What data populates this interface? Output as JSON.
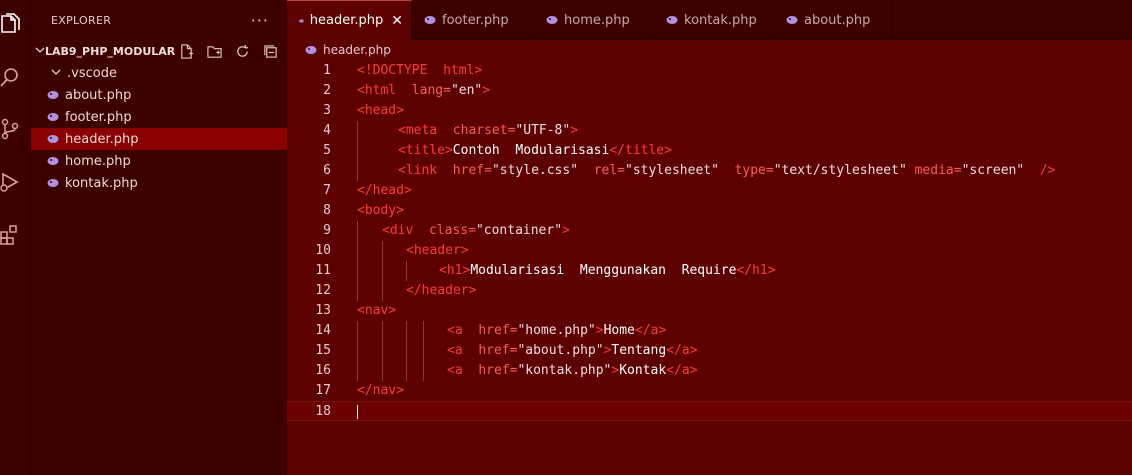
{
  "explorer": {
    "title": "EXPLORER",
    "more": "···",
    "folder": "LAB9_PHP_MODULAR",
    "items": [
      {
        "label": ".vscode",
        "kind": "folder"
      },
      {
        "label": "about.php",
        "kind": "php"
      },
      {
        "label": "footer.php",
        "kind": "php"
      },
      {
        "label": "header.php",
        "kind": "php",
        "selected": true
      },
      {
        "label": "home.php",
        "kind": "php"
      },
      {
        "label": "kontak.php",
        "kind": "php"
      }
    ]
  },
  "tabs": [
    {
      "label": "header.php",
      "active": true
    },
    {
      "label": "footer.php"
    },
    {
      "label": "home.php"
    },
    {
      "label": "kontak.php"
    },
    {
      "label": "about.php"
    }
  ],
  "close_glyph": "✕",
  "breadcrumb": "header.php",
  "code": {
    "line_numbers": [
      "1",
      "2",
      "3",
      "4",
      "5",
      "6",
      "7",
      "8",
      "9",
      "10",
      "11",
      "12",
      "13",
      "14",
      "15",
      "16",
      "17",
      "18"
    ],
    "lines": [
      [
        [
          "tg",
          "<!DOCTYPE  html>"
        ]
      ],
      [
        [
          "tg",
          "<html  "
        ],
        [
          "at",
          "lang="
        ],
        [
          "st",
          "\"en\""
        ],
        [
          "tg",
          ">"
        ]
      ],
      [
        [
          "tg",
          "<head>"
        ]
      ],
      [
        [
          "tg",
          "<meta  "
        ],
        [
          "at",
          "charset="
        ],
        [
          "st",
          "\"UTF-8\""
        ],
        [
          "tg",
          ">"
        ]
      ],
      [
        [
          "tg",
          "<title>"
        ],
        [
          "tx",
          "Contoh  Modularisasi"
        ],
        [
          "tg",
          "</title>"
        ]
      ],
      [
        [
          "tg",
          "<link  "
        ],
        [
          "at",
          "href="
        ],
        [
          "st",
          "\"style.css\"  "
        ],
        [
          "at",
          "rel="
        ],
        [
          "st",
          "\"stylesheet\"  "
        ],
        [
          "at",
          "type="
        ],
        [
          "st",
          "\"text/stylesheet\" "
        ],
        [
          "at",
          "media="
        ],
        [
          "st",
          "\"screen\"  "
        ],
        [
          "tg",
          "/>"
        ]
      ],
      [
        [
          "tg",
          "</head>"
        ]
      ],
      [
        [
          "tg",
          "<body>"
        ]
      ],
      [
        [
          "tg",
          "<div  "
        ],
        [
          "at",
          "class="
        ],
        [
          "st",
          "\"container\""
        ],
        [
          "tg",
          ">"
        ]
      ],
      [
        [
          "tg",
          "<header>"
        ]
      ],
      [
        [
          "tg",
          "<h1>"
        ],
        [
          "tx",
          "Modularisasi  Menggunakan  Require"
        ],
        [
          "tg",
          "</h1>"
        ]
      ],
      [
        [
          "tg",
          "</header>"
        ]
      ],
      [
        [
          "tg",
          "<nav>"
        ]
      ],
      [
        [
          "tg",
          "<a  "
        ],
        [
          "at",
          "href="
        ],
        [
          "st",
          "\"home.php\""
        ],
        [
          "tg",
          ">"
        ],
        [
          "tx",
          "Home"
        ],
        [
          "tg",
          "</a>"
        ]
      ],
      [
        [
          "tg",
          "<a  "
        ],
        [
          "at",
          "href="
        ],
        [
          "st",
          "\"about.php\""
        ],
        [
          "tg",
          ">"
        ],
        [
          "tx",
          "Tentang"
        ],
        [
          "tg",
          "</a>"
        ]
      ],
      [
        [
          "tg",
          "<a  "
        ],
        [
          "at",
          "href="
        ],
        [
          "st",
          "\"kontak.php\""
        ],
        [
          "tg",
          ">"
        ],
        [
          "tx",
          "Kontak"
        ],
        [
          "tg",
          "</a>"
        ]
      ],
      [
        [
          "tg",
          "</nav>"
        ]
      ],
      []
    ]
  },
  "colors": {
    "background": "#4a0000",
    "editor": "#5c0000",
    "tag": "#ff3b3b",
    "attribute": "#ff5a5a",
    "selected": "#8a0000"
  }
}
